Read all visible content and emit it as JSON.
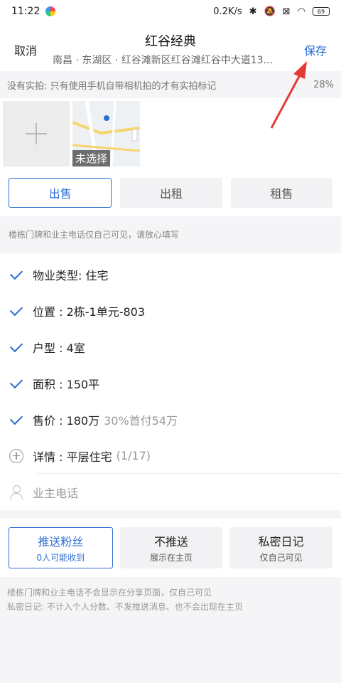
{
  "status": {
    "time": "11:22",
    "speed": "0.2K/s",
    "battery": "69"
  },
  "header": {
    "cancel": "取消",
    "title": "红谷经典",
    "save": "保存",
    "address": "南昌 · 东湖区 · 红谷滩新区红谷滩红谷中大道13..."
  },
  "hint": {
    "text": "没有实拍: 只有使用手机自带相机拍的才有实拍标记",
    "percent": "28%"
  },
  "photos": {
    "map_label": "未选择"
  },
  "tabs": [
    {
      "label": "出售"
    },
    {
      "label": "出租"
    },
    {
      "label": "租售"
    }
  ],
  "privacy_note": "楼栋门牌和业主电话仅自己可见，请放心填写",
  "fields": {
    "type": "物业类型: 住宅",
    "location": "位置 : 2栋-1单元-803",
    "layout": "户型 : 4室",
    "area": "面积 : 150平",
    "price": "售价 : 180万",
    "price_note": "30%首付54万",
    "detail": "详情 : 平层住宅",
    "detail_count": "(1/17)",
    "phone_placeholder": "业主电话"
  },
  "push": [
    {
      "main": "推送粉丝",
      "sub": "0人可能收到"
    },
    {
      "main": "不推送",
      "sub": "展示在主页"
    },
    {
      "main": "私密日记",
      "sub": "仅自己可见"
    }
  ],
  "notes": [
    "楼栋门牌和业主电话不会显示在分享页面，仅自己可见",
    "私密日记: 不计入个人分数、不发推送消息、也不会出现在主页"
  ],
  "colors": {
    "accent": "#2d6ed1",
    "annotation": "#e53935"
  }
}
